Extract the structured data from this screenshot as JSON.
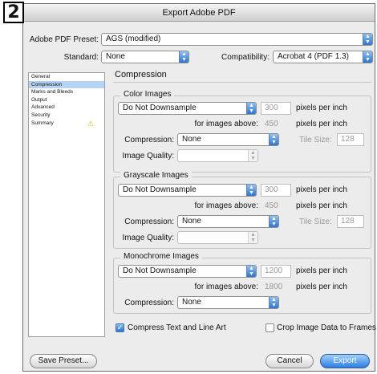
{
  "step_badge": "2",
  "window": {
    "title": "Export Adobe PDF"
  },
  "top": {
    "preset_label": "Adobe PDF Preset:",
    "preset_value": "AGS (modified)",
    "standard_label": "Standard:",
    "standard_value": "None",
    "compat_label": "Compatibility:",
    "compat_value": "Acrobat 4 (PDF 1.3)"
  },
  "sidebar": {
    "items": [
      "General",
      "Compression",
      "Marks and Bleeds",
      "Output",
      "Advanced",
      "Security",
      "Summary"
    ],
    "selected": "Compression"
  },
  "main": {
    "title": "Compression",
    "color": {
      "title": "Color Images",
      "downsample": "Do Not Downsample",
      "ppi": "300",
      "ppi_unit": "pixels per inch",
      "above_label": "for images above:",
      "above_value": "450",
      "above_unit": "pixels per inch",
      "compression_label": "Compression:",
      "compression_value": "None",
      "tile_label": "Tile Size:",
      "tile_value": "128",
      "quality_label": "Image Quality:",
      "quality_value": ""
    },
    "grayscale": {
      "title": "Grayscale Images",
      "downsample": "Do Not Downsample",
      "ppi": "300",
      "ppi_unit": "pixels per inch",
      "above_label": "for images above:",
      "above_value": "450",
      "above_unit": "pixels per inch",
      "compression_label": "Compression:",
      "compression_value": "None",
      "tile_label": "Tile Size:",
      "tile_value": "128",
      "quality_label": "Image Quality:",
      "quality_value": ""
    },
    "mono": {
      "title": "Monochrome Images",
      "downsample": "Do Not Downsample",
      "ppi": "1200",
      "ppi_unit": "pixels per inch",
      "above_label": "for images above:",
      "above_value": "1800",
      "above_unit": "pixels per inch",
      "compression_label": "Compression:",
      "compression_value": "None"
    },
    "compress_text": {
      "label": "Compress Text and Line Art",
      "checked": true
    },
    "crop_image": {
      "label": "Crop Image Data to Frames",
      "checked": false
    }
  },
  "buttons": {
    "save_preset": "Save Preset...",
    "cancel": "Cancel",
    "export": "Export"
  },
  "colors": {
    "accent": "#2f74d0",
    "selection": "#b5d3f3",
    "warning": "#e0b400"
  }
}
